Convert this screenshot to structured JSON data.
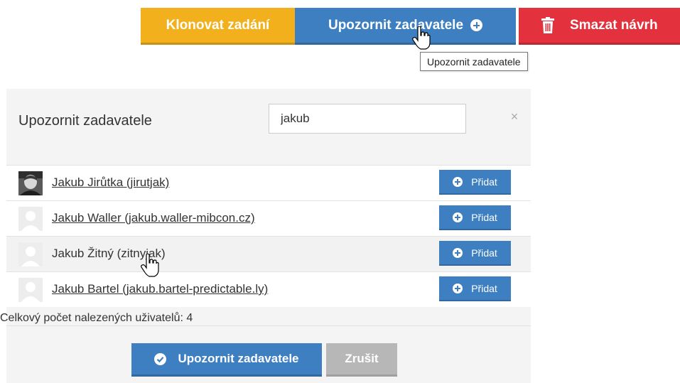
{
  "toolbar": {
    "clone_label": "Klonovat zadání",
    "notify_label": "Upozornit zadavatele",
    "delete_label": "Smazat návrh"
  },
  "tooltip": {
    "text": "Upozornit zadavatele"
  },
  "modal": {
    "title": "Upozornit zadavatele",
    "search_value": "jakub",
    "close_label": "×",
    "users": [
      {
        "name": "Jakub Jirůtka (jirutjak)",
        "add_label": "Přidat",
        "avatar": "photo"
      },
      {
        "name": "Jakub Waller (jakub.waller-mibcon.cz)",
        "add_label": "Přidat",
        "avatar": "placeholder"
      },
      {
        "name": "Jakub Žitný (zitnyjak)",
        "add_label": "Přidat",
        "avatar": "placeholder"
      },
      {
        "name": "Jakub Bartel (jakub.bartel-predictable.ly)",
        "add_label": "Přidat",
        "avatar": "placeholder"
      }
    ],
    "total_count_text": "Celkový počet nalezených uživatelů: 4",
    "confirm_label": "Upozornit zadavatele",
    "cancel_label": "Zrušit"
  },
  "colors": {
    "clone": "#f2b11c",
    "primary": "#3d7fc1",
    "danger": "#e3313d",
    "cancel": "#b7b7b7"
  },
  "icons": {
    "notify": "plus-circle-icon",
    "delete": "trash-icon",
    "add": "plus-circle-icon",
    "confirm": "check-circle-icon"
  }
}
